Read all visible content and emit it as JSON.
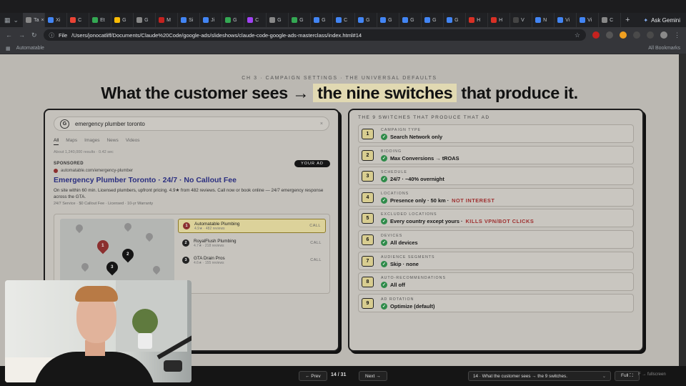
{
  "browser": {
    "tabs": [
      {
        "label": "Ta",
        "color": "#888"
      },
      {
        "label": "Xi",
        "color": "#4285f4"
      },
      {
        "label": "C",
        "color": "#ea4335"
      },
      {
        "label": "Et",
        "color": "#34a853"
      },
      {
        "label": "G",
        "color": "#fbbc05"
      },
      {
        "label": "G",
        "color": "#888"
      },
      {
        "label": "M",
        "color": "#c5221f"
      },
      {
        "label": "Si",
        "color": "#4285f4"
      },
      {
        "label": "Ji",
        "color": "#4285f4"
      },
      {
        "label": "G",
        "color": "#34a853"
      },
      {
        "label": "C",
        "color": "#a142f4"
      },
      {
        "label": "G",
        "color": "#888"
      },
      {
        "label": "G",
        "color": "#34a853"
      },
      {
        "label": "G",
        "color": "#4285f4"
      },
      {
        "label": "C",
        "color": "#4285f4"
      },
      {
        "label": "G",
        "color": "#4285f4"
      },
      {
        "label": "G",
        "color": "#4285f4"
      },
      {
        "label": "G",
        "color": "#4285f4"
      },
      {
        "label": "G",
        "color": "#4285f4"
      },
      {
        "label": "G",
        "color": "#4285f4"
      },
      {
        "label": "H",
        "color": "#d93025"
      },
      {
        "label": "H",
        "color": "#d93025"
      },
      {
        "label": "V",
        "color": "#444"
      },
      {
        "label": "N",
        "color": "#4285f4"
      },
      {
        "label": "Vi",
        "color": "#4285f4"
      },
      {
        "label": "Vi",
        "color": "#4285f4"
      },
      {
        "label": "C",
        "color": "#888"
      }
    ],
    "new_tab": "+",
    "ask_gemini": "Ask Gemini",
    "nav": {
      "back": "←",
      "forward": "→",
      "reload": "↻"
    },
    "address": {
      "chip": "File",
      "url": "/Users/jonocatliff/Documents/Claude%20Code/google-ads/slideshows/claude-code-google-ads-masterclass/index.html#14",
      "star": "☆"
    },
    "bookmarks": {
      "left": "Automatable",
      "right": "All Bookmarks"
    }
  },
  "slide": {
    "eyebrow": "CH 3 · CAMPAIGN SETTINGS · THE UNIVERSAL DEFAULTS",
    "headline_pre": "What the customer sees → ",
    "headline_hl": "the nine switches",
    "headline_post": " that produce it."
  },
  "serp": {
    "g_logo": "G",
    "query": "emergency plumber toronto",
    "clear": "×",
    "tabs": [
      "All",
      "Maps",
      "Images",
      "News",
      "Videos"
    ],
    "results_count": "About 1,240,000 results · 0.42 sec",
    "sponsored": "SPONSORED",
    "your_ad": "YOUR AD",
    "ad_url": "automatable.com/emergency-plumber",
    "ad_title": "Emergency Plumber Toronto · 24/7 · No Callout Fee",
    "ad_desc": "On site within 60 min. Licensed plumbers, upfront pricing. 4.9★ from 482 reviews. Call now or book online — 24/7 emergency response across the GTA.",
    "ad_ext": "24/7 Service · $0 Callout Fee · Licensed · 10-yr Warranty",
    "listings": [
      {
        "num": "1",
        "name": "Automatable Plumbing",
        "reviews": "4.9★ · 482 reviews",
        "call": "CALL",
        "color": "#8b2f2f"
      },
      {
        "num": "2",
        "name": "RoyalFlush Plumbing",
        "reviews": "4.7★ · 218 reviews",
        "call": "CALL",
        "color": "#222"
      },
      {
        "num": "3",
        "name": "GTA Drain Pros",
        "reviews": "4.6★ · 155 reviews",
        "call": "CALL",
        "color": "#222"
      }
    ],
    "map_pins": [
      {
        "label": "1",
        "color": "#8b2f2f"
      },
      {
        "label": "2",
        "color": "#151515"
      },
      {
        "label": "3",
        "color": "#151515"
      }
    ]
  },
  "switches": {
    "title": "THE 9 SWITCHES THAT PRODUCE THAT AD",
    "items": [
      {
        "num": "1",
        "label": "CAMPAIGN TYPE",
        "value": "Search Network only",
        "warn": ""
      },
      {
        "num": "2",
        "label": "BIDDING",
        "value": "Max Conversions → tROAS",
        "warn": ""
      },
      {
        "num": "3",
        "label": "SCHEDULE",
        "value": "24/7 · −40% overnight",
        "warn": ""
      },
      {
        "num": "4",
        "label": "LOCATIONS",
        "value": "Presence only · 50 km ·",
        "warn": "NOT INTEREST"
      },
      {
        "num": "5",
        "label": "EXCLUDED LOCATIONS",
        "value": "Every country except yours ·",
        "warn": "KILLS VPN/BOT CLICKS"
      },
      {
        "num": "6",
        "label": "DEVICES",
        "value": "All devices",
        "warn": ""
      },
      {
        "num": "7",
        "label": "AUDIENCE SEGMENTS",
        "value": "Skip · none",
        "warn": ""
      },
      {
        "num": "8",
        "label": "AUTO-RECOMMENDATIONS",
        "value": "All off",
        "warn": ""
      },
      {
        "num": "9",
        "label": "AD ROTATION",
        "value": "Optimize (default)",
        "warn": ""
      }
    ]
  },
  "controls": {
    "prev": "← Prev",
    "page": "14 / 31",
    "next": "Next →",
    "jump": "14 · What the customer sees → the 9 switches.",
    "full": "Full ⛶",
    "hint": "F → fullscreen"
  },
  "colors": {
    "accent_num": "#d8cd90",
    "check": "#2f8b4a",
    "warn": "#9e2f2f",
    "ad_title": "#2b2f80"
  }
}
